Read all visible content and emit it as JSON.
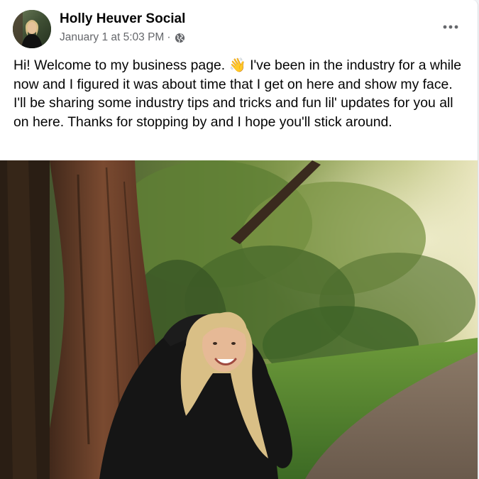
{
  "post": {
    "author": "Holly Heuver Social",
    "timestamp": "January 1 at 5:03 PM",
    "separator": "·",
    "audience_icon": "globe-icon",
    "more_icon": "more-options-icon",
    "text": "Hi! Welcome to my business page. 👋 I've been in the industry for a while now and I figured it was about time that I get on here and show my face. I'll be sharing some industry tips and tricks and fun lil' updates for you all on here. Thanks for stopping by and I hope you'll stick around.",
    "photo_alt": "Woman in a black jacket smiling over her shoulder on a forest trail"
  },
  "colors": {
    "text_primary": "#050505",
    "text_secondary": "#65676b",
    "background": "#ffffff"
  }
}
